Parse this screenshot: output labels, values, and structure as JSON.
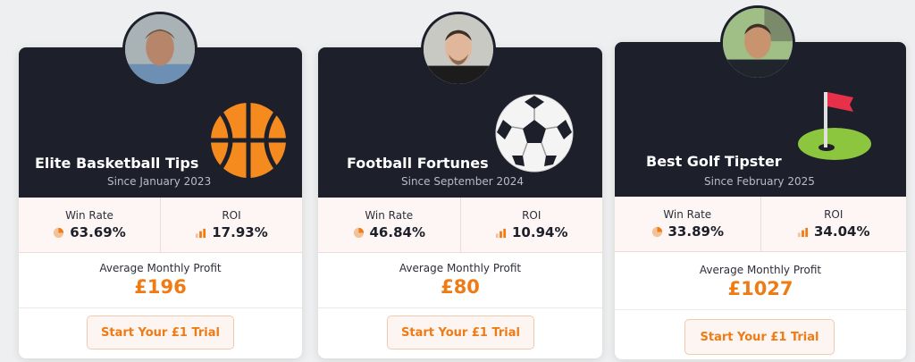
{
  "theme": {
    "header_bg": "#1d1f2b",
    "accent": "#f07a14",
    "stats_bg": "#fdf6f4"
  },
  "cards": [
    {
      "title": "Elite Basketball Tips",
      "since": "Since January 2023",
      "sport_icon": "basketball-icon",
      "win_rate_label": "Win Rate",
      "win_rate": "63.69%",
      "roi_label": "ROI",
      "roi": "17.93%",
      "profit_label": "Average Monthly Profit",
      "profit": "£196",
      "button": "Start Your £1 Trial"
    },
    {
      "title": "Football Fortunes",
      "since": "Since September 2024",
      "sport_icon": "football-icon",
      "win_rate_label": "Win Rate",
      "win_rate": "46.84%",
      "roi_label": "ROI",
      "roi": "10.94%",
      "profit_label": "Average Monthly Profit",
      "profit": "£80",
      "button": "Start Your £1 Trial"
    },
    {
      "title": "Best Golf Tipster",
      "since": "Since February 2025",
      "sport_icon": "golf-flag-icon",
      "win_rate_label": "Win Rate",
      "win_rate": "33.89%",
      "roi_label": "ROI",
      "roi": "34.04%",
      "profit_label": "Average Monthly Profit",
      "profit": "£1027",
      "button": "Start Your £1 Trial"
    }
  ]
}
